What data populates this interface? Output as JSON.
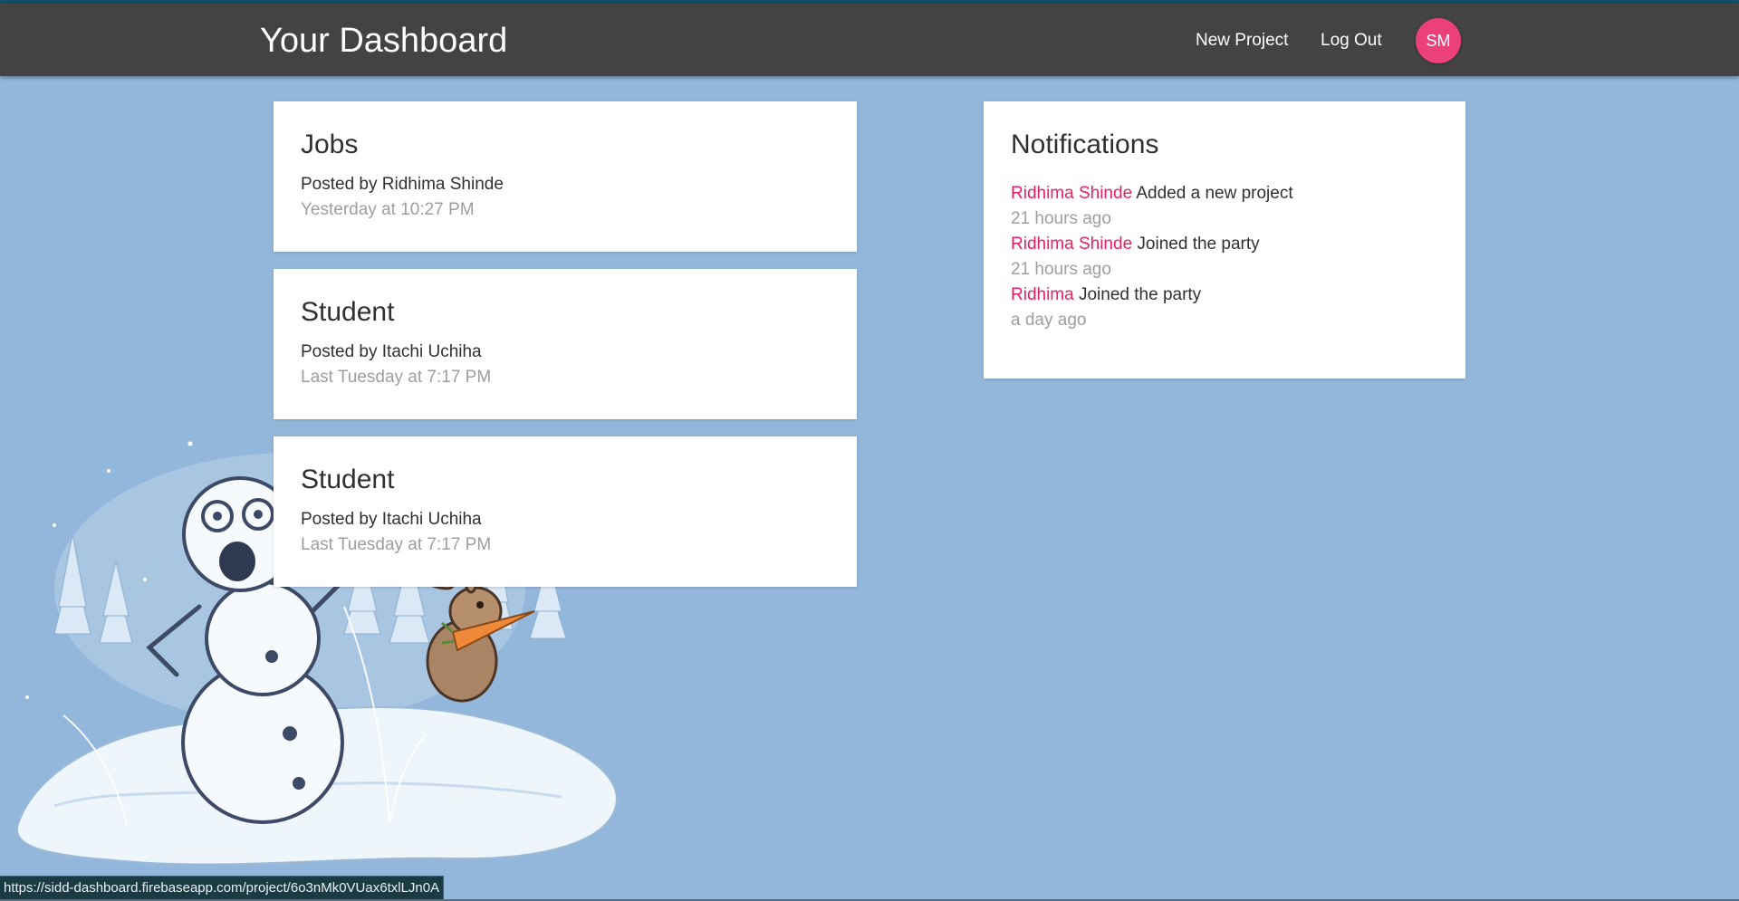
{
  "navbar": {
    "brand": "Your Dashboard",
    "links": [
      {
        "label": "New Project"
      },
      {
        "label": "Log Out"
      }
    ],
    "avatar_initials": "SM",
    "avatar_color": "#ec407a",
    "background_color": "#434343"
  },
  "projects": [
    {
      "title": "Jobs",
      "posted_by": "Posted by Ridhima Shinde",
      "date": "Yesterday at 10:27 PM"
    },
    {
      "title": "Student",
      "posted_by": "Posted by Itachi Uchiha",
      "date": "Last Tuesday at 7:17 PM"
    },
    {
      "title": "Student",
      "posted_by": "Posted by Itachi Uchiha",
      "date": "Last Tuesday at 7:17 PM"
    }
  ],
  "notifications": {
    "title": "Notifications",
    "items": [
      {
        "user": "Ridhima Shinde",
        "content": "Added a new project",
        "time": "21 hours ago"
      },
      {
        "user": "Ridhima Shinde",
        "content": "Joined the party",
        "time": "21 hours ago"
      },
      {
        "user": "Ridhima",
        "content": "Joined the party",
        "time": "a day ago"
      }
    ]
  },
  "status_bar": {
    "url": "https://sidd-dashboard.firebaseapp.com/project/6o3nMk0VUax6txlLJn0A"
  },
  "colors": {
    "page_background": "#93b7da",
    "accent": "#e91e63",
    "muted_text": "#9e9e9e"
  }
}
